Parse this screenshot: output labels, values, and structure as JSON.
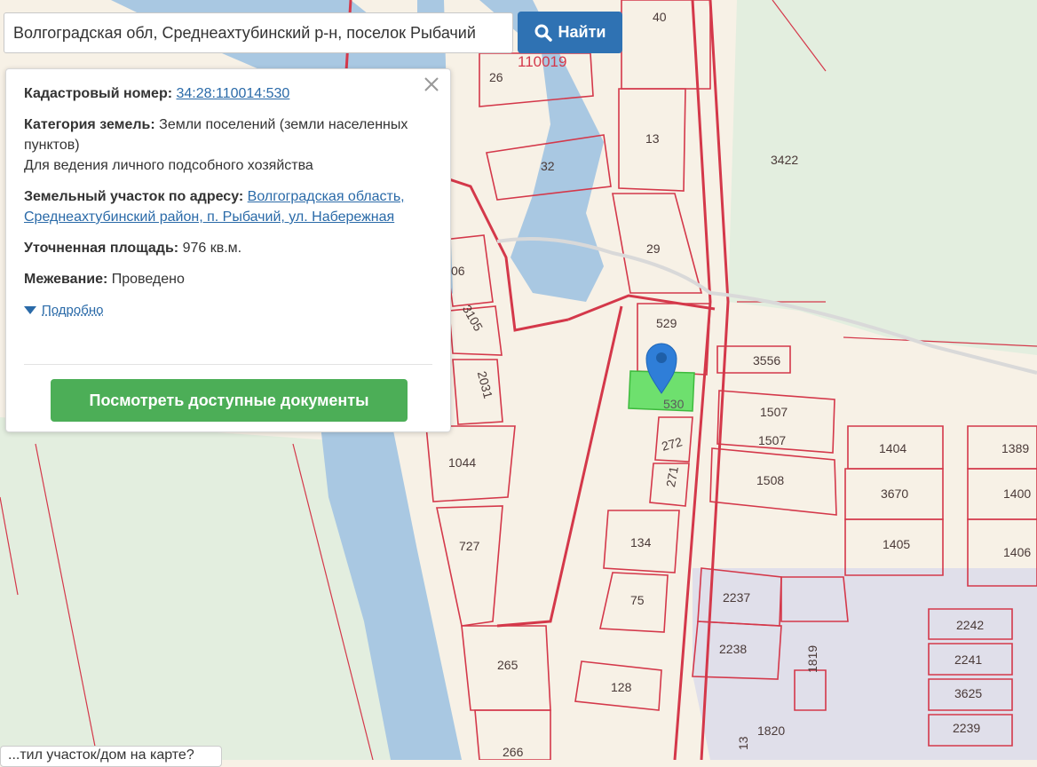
{
  "search": {
    "value": "Волгоградская обл, Среднеахтубинский р-н, поселок Рыбачий",
    "button_label": "Найти"
  },
  "info": {
    "cadastral_label": "Кадастровый номер:",
    "cadastral_value": "34:28:110014:530",
    "category_label": "Категория земель:",
    "category_value": "Земли поселений (земли населенных пунктов)",
    "usage": "Для ведения личного подсобного хозяйства",
    "address_label": "Земельный участок по адресу:",
    "address_value": "Волгоградская область, Среднеахтубинский район, п. Рыбачий, ул. Набережная",
    "area_label": "Уточненная площадь:",
    "area_value": "976 кв.м.",
    "survey_label": "Межевание:",
    "survey_value": "Проведено",
    "more_label": "Подробно",
    "docs_button": "Посмотреть доступные документы"
  },
  "bottom_tip": "...тил участок/дом на карте?",
  "map": {
    "labels": [
      "40",
      "110019",
      "26",
      "13",
      "32",
      "3422",
      "29",
      "529",
      "3556",
      "530",
      "1507",
      "1507",
      "272",
      "1404",
      "1389",
      "1508",
      "271",
      "3670",
      "1400",
      "1044",
      "727",
      "134",
      "1405",
      "1406",
      "75",
      "2237",
      "2242",
      "2238",
      "2241",
      "265",
      "128",
      "1819",
      "3625",
      "2239",
      "1820",
      "266",
      "3105",
      "2031",
      "06",
      "13"
    ],
    "colors": {
      "parcel_line": "#d4384a",
      "river": "#a9c8e2",
      "green": "#e3eedf",
      "selected": "#6ee06e",
      "built": "#e0dfea",
      "marker": "#2f7ed8"
    }
  }
}
